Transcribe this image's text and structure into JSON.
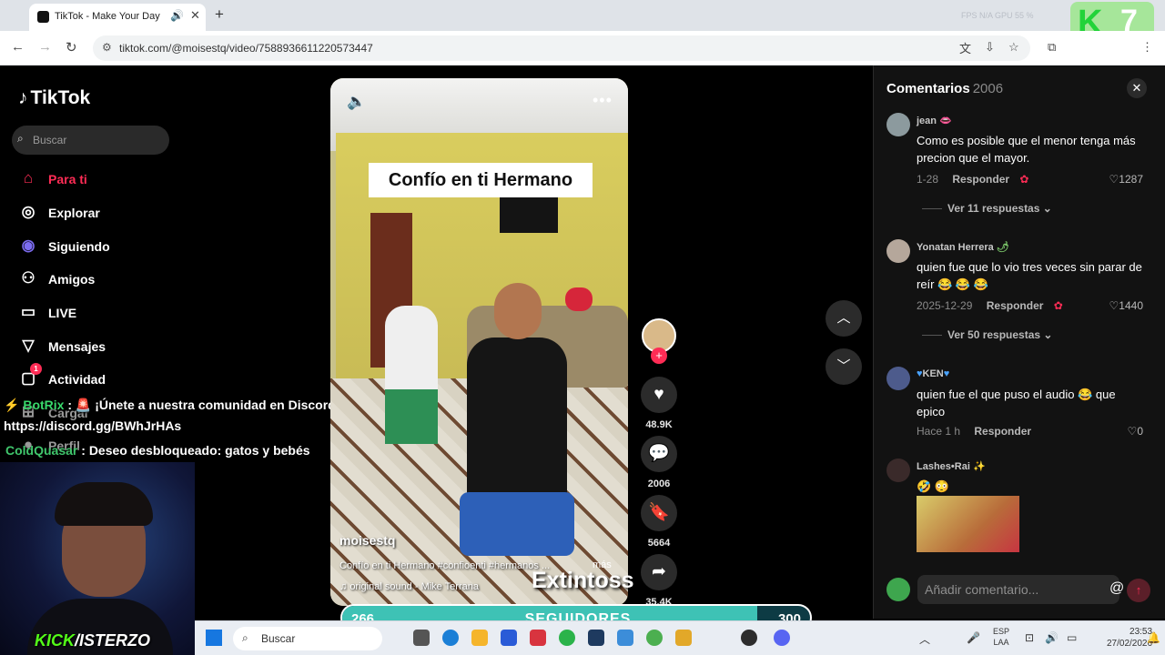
{
  "browser": {
    "tab_title": "TikTok - Make Your Day",
    "url": "tiktok.com/@moisestq/video/7588936611220573447",
    "stats_text": "FPS N/A    GPU 55 %"
  },
  "kick_overlay": {
    "letter": "K",
    "number": "7"
  },
  "sidebar": {
    "logo": "TikTok",
    "search_placeholder": "Buscar",
    "items": [
      {
        "label": "Para ti",
        "icon": "home-icon"
      },
      {
        "label": "Explorar",
        "icon": "compass-icon"
      },
      {
        "label": "Siguiendo",
        "icon": "following-icon"
      },
      {
        "label": "Amigos",
        "icon": "friends-icon"
      },
      {
        "label": "LIVE",
        "icon": "live-icon"
      },
      {
        "label": "Mensajes",
        "icon": "messages-icon"
      },
      {
        "label": "Actividad",
        "icon": "activity-icon",
        "badge": "1"
      },
      {
        "label": "Cargar",
        "icon": "upload-icon"
      },
      {
        "label": "Perfil",
        "icon": "profile-icon"
      }
    ]
  },
  "stream_chat": [
    {
      "user": "BotRix",
      "text": "¡Únete a nuestra comunidad en Discord!",
      "link": "https://discord.gg/BWhJrHAs"
    },
    {
      "user": "ColdQuasar",
      "text": "Deseo desbloqueado: gatos y bebés"
    }
  ],
  "streamer": {
    "brand_kick": "KICK",
    "brand_name": "/ISTERZO"
  },
  "video": {
    "caption_overlay": "Confío en ti Hermano",
    "author": "moisestq",
    "description": "Confío en ti Hermano #confioenti #hermanos ...",
    "more": "más",
    "music": "original sound - Mike Terrana",
    "watermark": "Extintoss"
  },
  "actions": {
    "likes": "48.9K",
    "comments": "2006",
    "saves": "5664",
    "shares": "35.4K"
  },
  "comments": {
    "title": "Comentarios",
    "count": "2006",
    "items": [
      {
        "user": "jean",
        "text": "Como es posible que el menor tenga más precion que el mayor.",
        "date": "1-28",
        "reply": "Responder",
        "likes": "1287",
        "replies": "Ver 11 respuestas"
      },
      {
        "user": "Yonatan Herrera",
        "text": "quien fue que lo vio tres veces sin parar de reír 😂 😂 😂",
        "date": "2025-12-29",
        "reply": "Responder",
        "likes": "1440",
        "replies": "Ver 50 respuestas"
      },
      {
        "user": "KEN",
        "text": "quien fue el que puso el audio 😂 que epico",
        "date": "Hace 1 h",
        "reply": "Responder",
        "likes": "0"
      },
      {
        "user": "Lashes•Rai",
        "text": "🤣 😳"
      }
    ],
    "input_placeholder": "Añadir comentario..."
  },
  "follower_goal": {
    "current": "266",
    "label": "SEGUIDORES",
    "target": "300",
    "progress": 0.887
  },
  "taskbar": {
    "search": "Buscar",
    "lang_top": "ESP",
    "lang_bottom": "LAA",
    "time": "23:53",
    "date": "27/02/2026"
  }
}
